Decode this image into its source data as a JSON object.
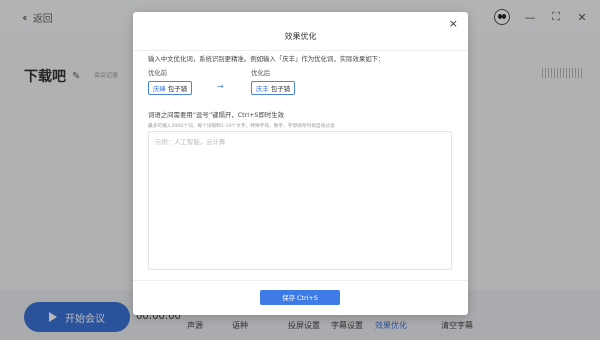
{
  "app": {
    "back_label": "返回",
    "doc_title": "下载吧",
    "doc_subtitle": "会议记录",
    "start_button": "开始会议",
    "timer": "00:00:00",
    "bottom_tabs": [
      {
        "label": "声源",
        "active": false
      },
      {
        "label": "语种",
        "active": false
      },
      {
        "label": "投屏设置",
        "active": false
      },
      {
        "label": "字幕设置",
        "active": false
      },
      {
        "label": "效果优化",
        "active": true
      },
      {
        "label": "清空字幕",
        "active": false
      }
    ],
    "window_controls": [
      "minimize-icon",
      "maximize-icon",
      "close-icon"
    ]
  },
  "modal": {
    "title": "效果优化",
    "close": "×",
    "instruction": "输入中文优化词，系统识别更精准。例如输入「庆丰」作为优化词，实际效果如下：",
    "before_label": "优化前",
    "after_label": "优化后",
    "before_word": "庆峰",
    "before_rest": " 包子铺",
    "after_word": "庆丰",
    "after_rest": " 包子铺",
    "arrow": "→",
    "rule": "词语之间需要用“逗号”键隔开，Ctrl+S即时生效",
    "limit": "最多可输入2000个词，每个词限制1-10个文字，特殊字符、数字、字母保存时将自动过滤",
    "placeholder": "示例：人工智能，云计算",
    "save_button": "保存 Ctrl+S"
  },
  "colors": {
    "accent": "#3b73d9",
    "overlay": "rgba(0,0,0,0.28)"
  }
}
